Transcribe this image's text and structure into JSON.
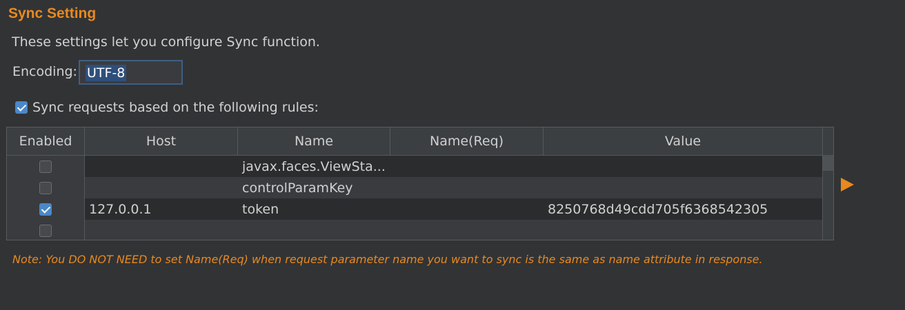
{
  "title": "Sync Setting",
  "description": "These settings let you configure Sync function.",
  "encoding": {
    "label": "Encoding:",
    "value": "UTF-8"
  },
  "sync_rules": {
    "label": "Sync requests based on the following rules:",
    "checked": true
  },
  "table": {
    "columns": [
      "Enabled",
      "Host",
      "Name",
      "Name(Req)",
      "Value"
    ],
    "rows": [
      {
        "enabled": false,
        "host": "",
        "name": "javax.faces.ViewSta...",
        "name_req": "",
        "value": ""
      },
      {
        "enabled": false,
        "host": "",
        "name": "controlParamKey",
        "name_req": "",
        "value": ""
      },
      {
        "enabled": true,
        "host": "127.0.0.1",
        "name": "token",
        "name_req": "",
        "value": "8250768d49cdd705f6368542305"
      },
      {
        "enabled": false,
        "host": "",
        "name": "",
        "name_req": "",
        "value": ""
      }
    ]
  },
  "expand_icon": "triangle-right-icon",
  "note": "Note: You DO NOT NEED to set Name(Req) when request parameter name you want to sync is the same as name attribute in response.",
  "colors": {
    "accent": "#e8891f",
    "checkbox_checked": "#4a88c7",
    "background": "#323335"
  }
}
